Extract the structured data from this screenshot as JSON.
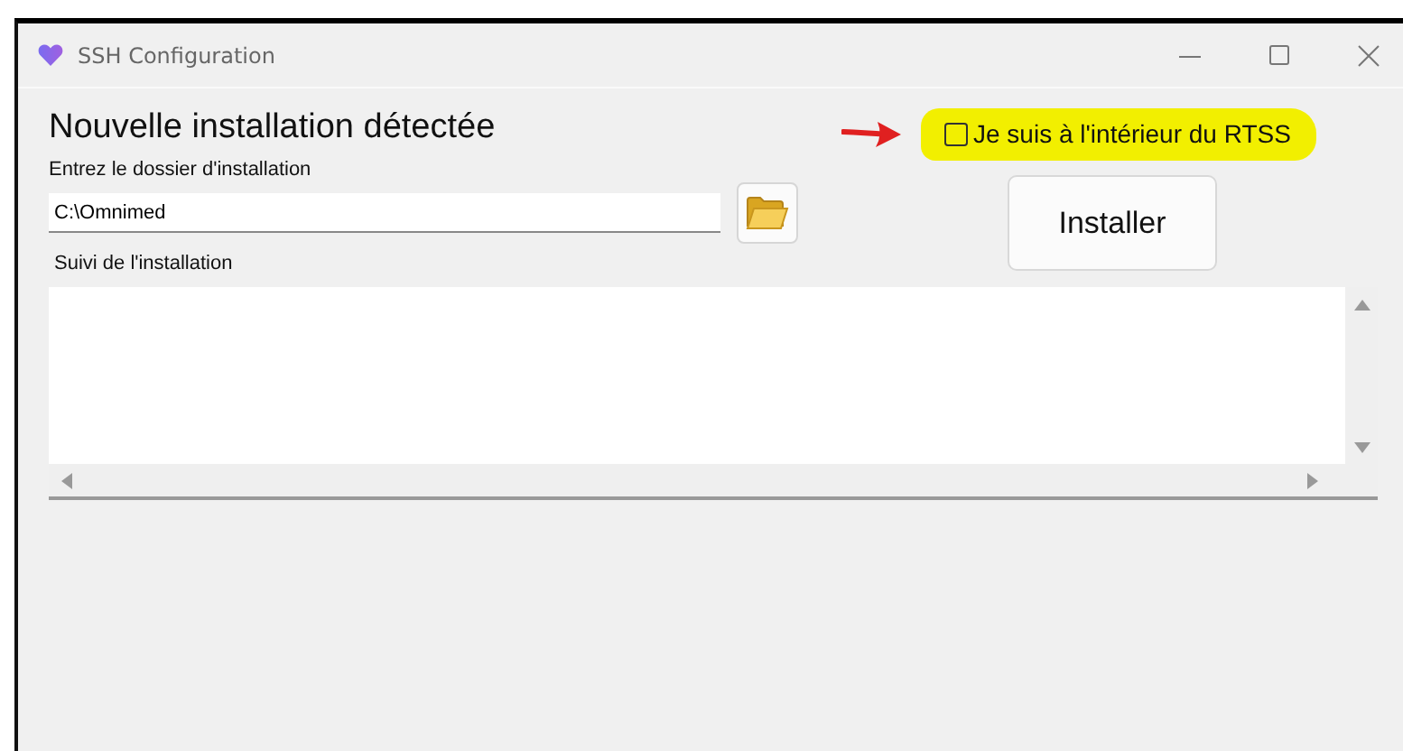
{
  "window": {
    "title": "SSH Configuration"
  },
  "heading": "Nouvelle installation détectée",
  "folder": {
    "label": "Entrez le dossier d'installation",
    "value": "C:\\Omnimed"
  },
  "rtss_option": {
    "label": "Je suis à l'intérieur du RTSS",
    "checked": false
  },
  "install_button": "Installer",
  "log": {
    "label": "Suivi de l'installation"
  }
}
